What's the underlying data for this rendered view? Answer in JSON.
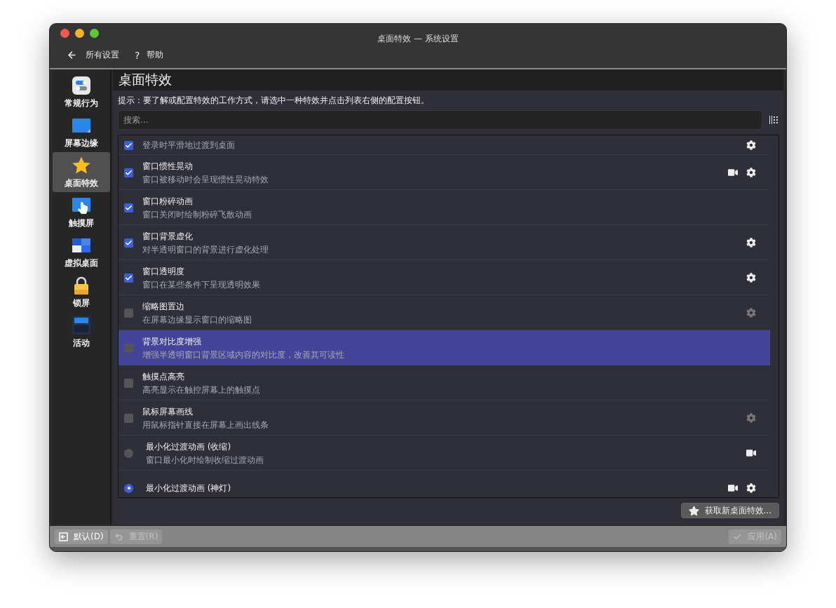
{
  "window": {
    "title": "桌面特效 — 系统设置"
  },
  "toolbar": {
    "back_label": "所有设置",
    "help_mark": "?",
    "help_label": "帮助"
  },
  "sidebar": {
    "items": [
      {
        "kind": "general",
        "label": "常规行为",
        "selected": false
      },
      {
        "kind": "edges",
        "label": "屏幕边缘",
        "selected": false
      },
      {
        "kind": "effects",
        "label": "桌面特效",
        "selected": true
      },
      {
        "kind": "touch",
        "label": "触摸屏",
        "selected": false
      },
      {
        "kind": "desktops",
        "label": "虚拟桌面",
        "selected": false
      },
      {
        "kind": "lock",
        "label": "锁屏",
        "selected": false
      },
      {
        "kind": "activities",
        "label": "活动",
        "selected": false
      }
    ]
  },
  "page": {
    "title": "桌面特效",
    "hint": "提示：要了解或配置特效的工作方式，请选中一种特效并点击列表右侧的配置按钮。",
    "search": {
      "placeholder": "搜索..."
    }
  },
  "effects": [
    {
      "kind": "checkbox",
      "description": "登录时平滑地过渡到桌面",
      "checked": true,
      "selected": false,
      "video": false,
      "settings": true,
      "settings_enabled": true
    },
    {
      "kind": "checkbox",
      "title": "窗口惯性晃动",
      "description": "窗口被移动时会呈现惯性晃动特效",
      "checked": true,
      "selected": false,
      "video": true,
      "settings": true,
      "settings_enabled": true
    },
    {
      "kind": "checkbox",
      "title": "窗口粉碎动画",
      "description": "窗口关闭时绘制粉碎飞散动画",
      "checked": true,
      "selected": false,
      "video": false
    },
    {
      "kind": "checkbox",
      "title": "窗口背景虚化",
      "description": "对半透明窗口的背景进行虚化处理",
      "checked": true,
      "selected": false,
      "video": false,
      "settings": true,
      "settings_enabled": true
    },
    {
      "kind": "checkbox",
      "title": "窗口透明度",
      "description": "窗口在某些条件下呈现透明效果",
      "checked": true,
      "selected": false,
      "video": false,
      "settings": true,
      "settings_enabled": true
    },
    {
      "kind": "checkbox",
      "title": "缩略图置边",
      "description": "在屏幕边缘显示窗口的缩略图",
      "checked": false,
      "selected": false,
      "video": false,
      "settings": true,
      "settings_enabled": false
    },
    {
      "kind": "checkbox",
      "title": "背景对比度增强",
      "description": "增强半透明窗口背景区域内容的对比度，改善其可读性",
      "checked": false,
      "selected": true,
      "video": false
    },
    {
      "kind": "checkbox",
      "title": "触摸点高亮",
      "description": "高亮显示在触控屏幕上的触摸点",
      "checked": false,
      "selected": false,
      "video": false
    },
    {
      "kind": "checkbox",
      "title": "鼠标屏幕画线",
      "description": "用鼠标指针直接在屏幕上画出线条",
      "checked": false,
      "selected": false,
      "video": false,
      "settings": true,
      "settings_enabled": false
    },
    {
      "kind": "radio",
      "title": "最小化过渡动画 (收缩)",
      "description": "窗口最小化时绘制收缩过渡动画",
      "checked": false,
      "selected": false,
      "video": true
    },
    {
      "kind": "radio",
      "title": "最小化过渡动画 (神灯)",
      "checked": true,
      "selected": false,
      "video": true,
      "settings": true,
      "settings_enabled": true
    }
  ],
  "get_new_button": "获取新桌面特效...",
  "footer": {
    "defaults": {
      "label": "默认(D)",
      "disabled": false
    },
    "reset": {
      "label": "重置(R)",
      "disabled": true
    },
    "apply": {
      "label": "应用(A)",
      "disabled": true
    }
  }
}
